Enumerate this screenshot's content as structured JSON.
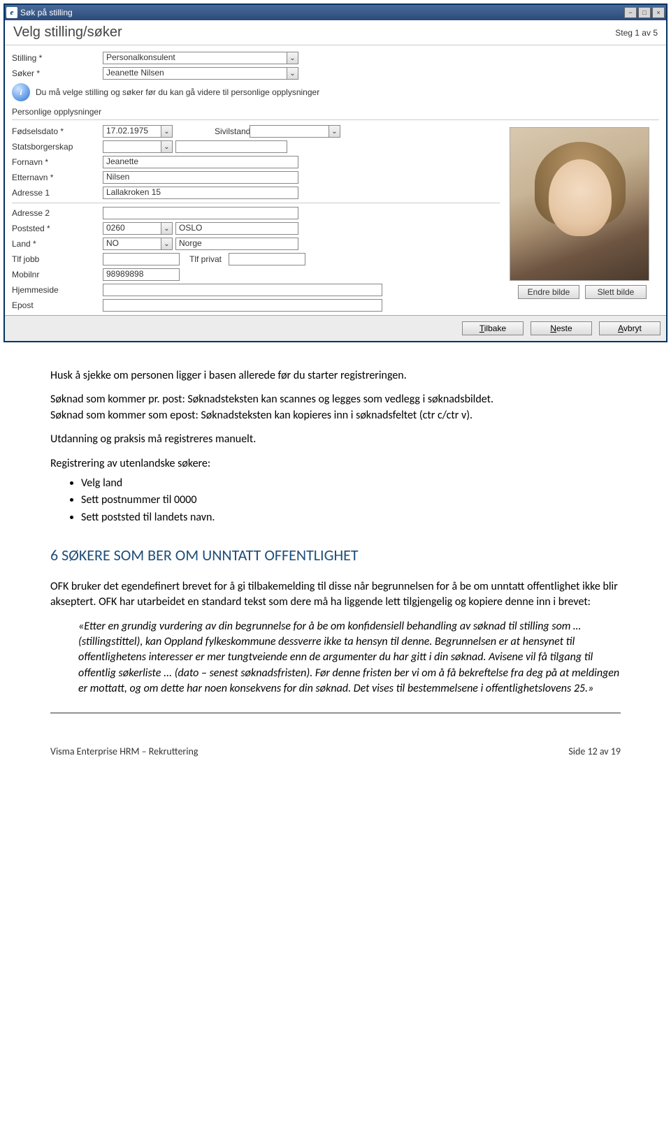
{
  "dialog": {
    "title": "Søk på stilling",
    "stepTitle": "Velg stilling/søker",
    "stepIndicator": "Steg 1 av 5",
    "stillingLabel": "Stilling *",
    "stillingValue": "Personalkonsulent",
    "sokerLabel": "Søker *",
    "sokerValue": "Jeanette Nilsen",
    "infoText": "Du må velge stilling og søker før du kan gå videre til personlige opplysninger",
    "sectionLabel": "Personlige opplysninger",
    "fields": {
      "fodselsdatoLabel": "Fødselsdato *",
      "fodselsdatoValue": "17.02.1975",
      "sivilstandLabel": "Sivilstand",
      "statsborgerskapLabel": "Statsborgerskap",
      "fornavnLabel": "Fornavn *",
      "fornavnValue": "Jeanette",
      "etternavnLabel": "Etternavn *",
      "etternavnValue": "Nilsen",
      "adresse1Label": "Adresse 1",
      "adresse1Value": "Lallakroken 15",
      "adresse2Label": "Adresse 2",
      "poststedLabel": "Poststed *",
      "poststedCode": "0260",
      "poststedName": "OSLO",
      "landLabel": "Land *",
      "landCode": "NO",
      "landName": "Norge",
      "tlfJobbLabel": "Tlf jobb",
      "tlfPrivatLabel": "Tlf privat",
      "mobilnrLabel": "Mobilnr",
      "mobilnrValue": "98989898",
      "hjemmesideLabel": "Hjemmeside",
      "epostLabel": "Epost"
    },
    "photo": {
      "editLabel": "Endre bilde",
      "deleteLabel": "Slett bilde"
    },
    "buttons": {
      "back": "Tilbake",
      "next": "Neste",
      "cancel": "Avbryt"
    }
  },
  "content": {
    "p1": "Husk å sjekke om personen ligger i basen allerede før du starter registreringen.",
    "p2": "Søknad som kommer pr. post: Søknadsteksten kan scannes og legges som vedlegg i søknadsbildet.",
    "p3": "Søknad som kommer som epost: Søknadsteksten kan kopieres inn i søknadsfeltet (ctr c/ctr v).",
    "p4": "Utdanning og praksis må registreres manuelt.",
    "p5": "Registrering av utenlandske søkere:",
    "bullets": [
      "Velg land",
      "Sett postnummer til 0000",
      "Sett poststed til landets navn."
    ],
    "h2": "6 SØKERE SOM BER OM UNNTATT OFFENTLIGHET",
    "p6": "OFK bruker det egendefinert brevet for å gi tilbakemelding til disse når begrunnelsen for å be om unntatt offentlighet ikke blir akseptert. OFK har utarbeidet en standard tekst som dere må ha liggende lett tilgjengelig og kopiere denne inn i brevet:",
    "quote": "«Etter en grundig vurdering av din begrunnelse for å be om konfidensiell behandling av søknad til stilling som … (stillingstittel), kan Oppland fylkeskommune dessverre ikke ta hensyn til denne. Begrunnelsen er at hensynet til offentlighetens interesser er mer tungtveiende enn de argumenter du har gitt i din søknad. Avisene vil få tilgang til offentlig søkerliste ... (dato – senest søknadsfristen). Før denne fristen ber vi om å få bekreftelse fra deg på at meldingen er mottatt, og om dette har noen konsekvens for din søknad. Det vises til bestemmelsene i offentlighetslovens 25.»"
  },
  "footer": {
    "left": "Visma Enterprise HRM – Rekruttering",
    "right": "Side 12 av 19"
  }
}
